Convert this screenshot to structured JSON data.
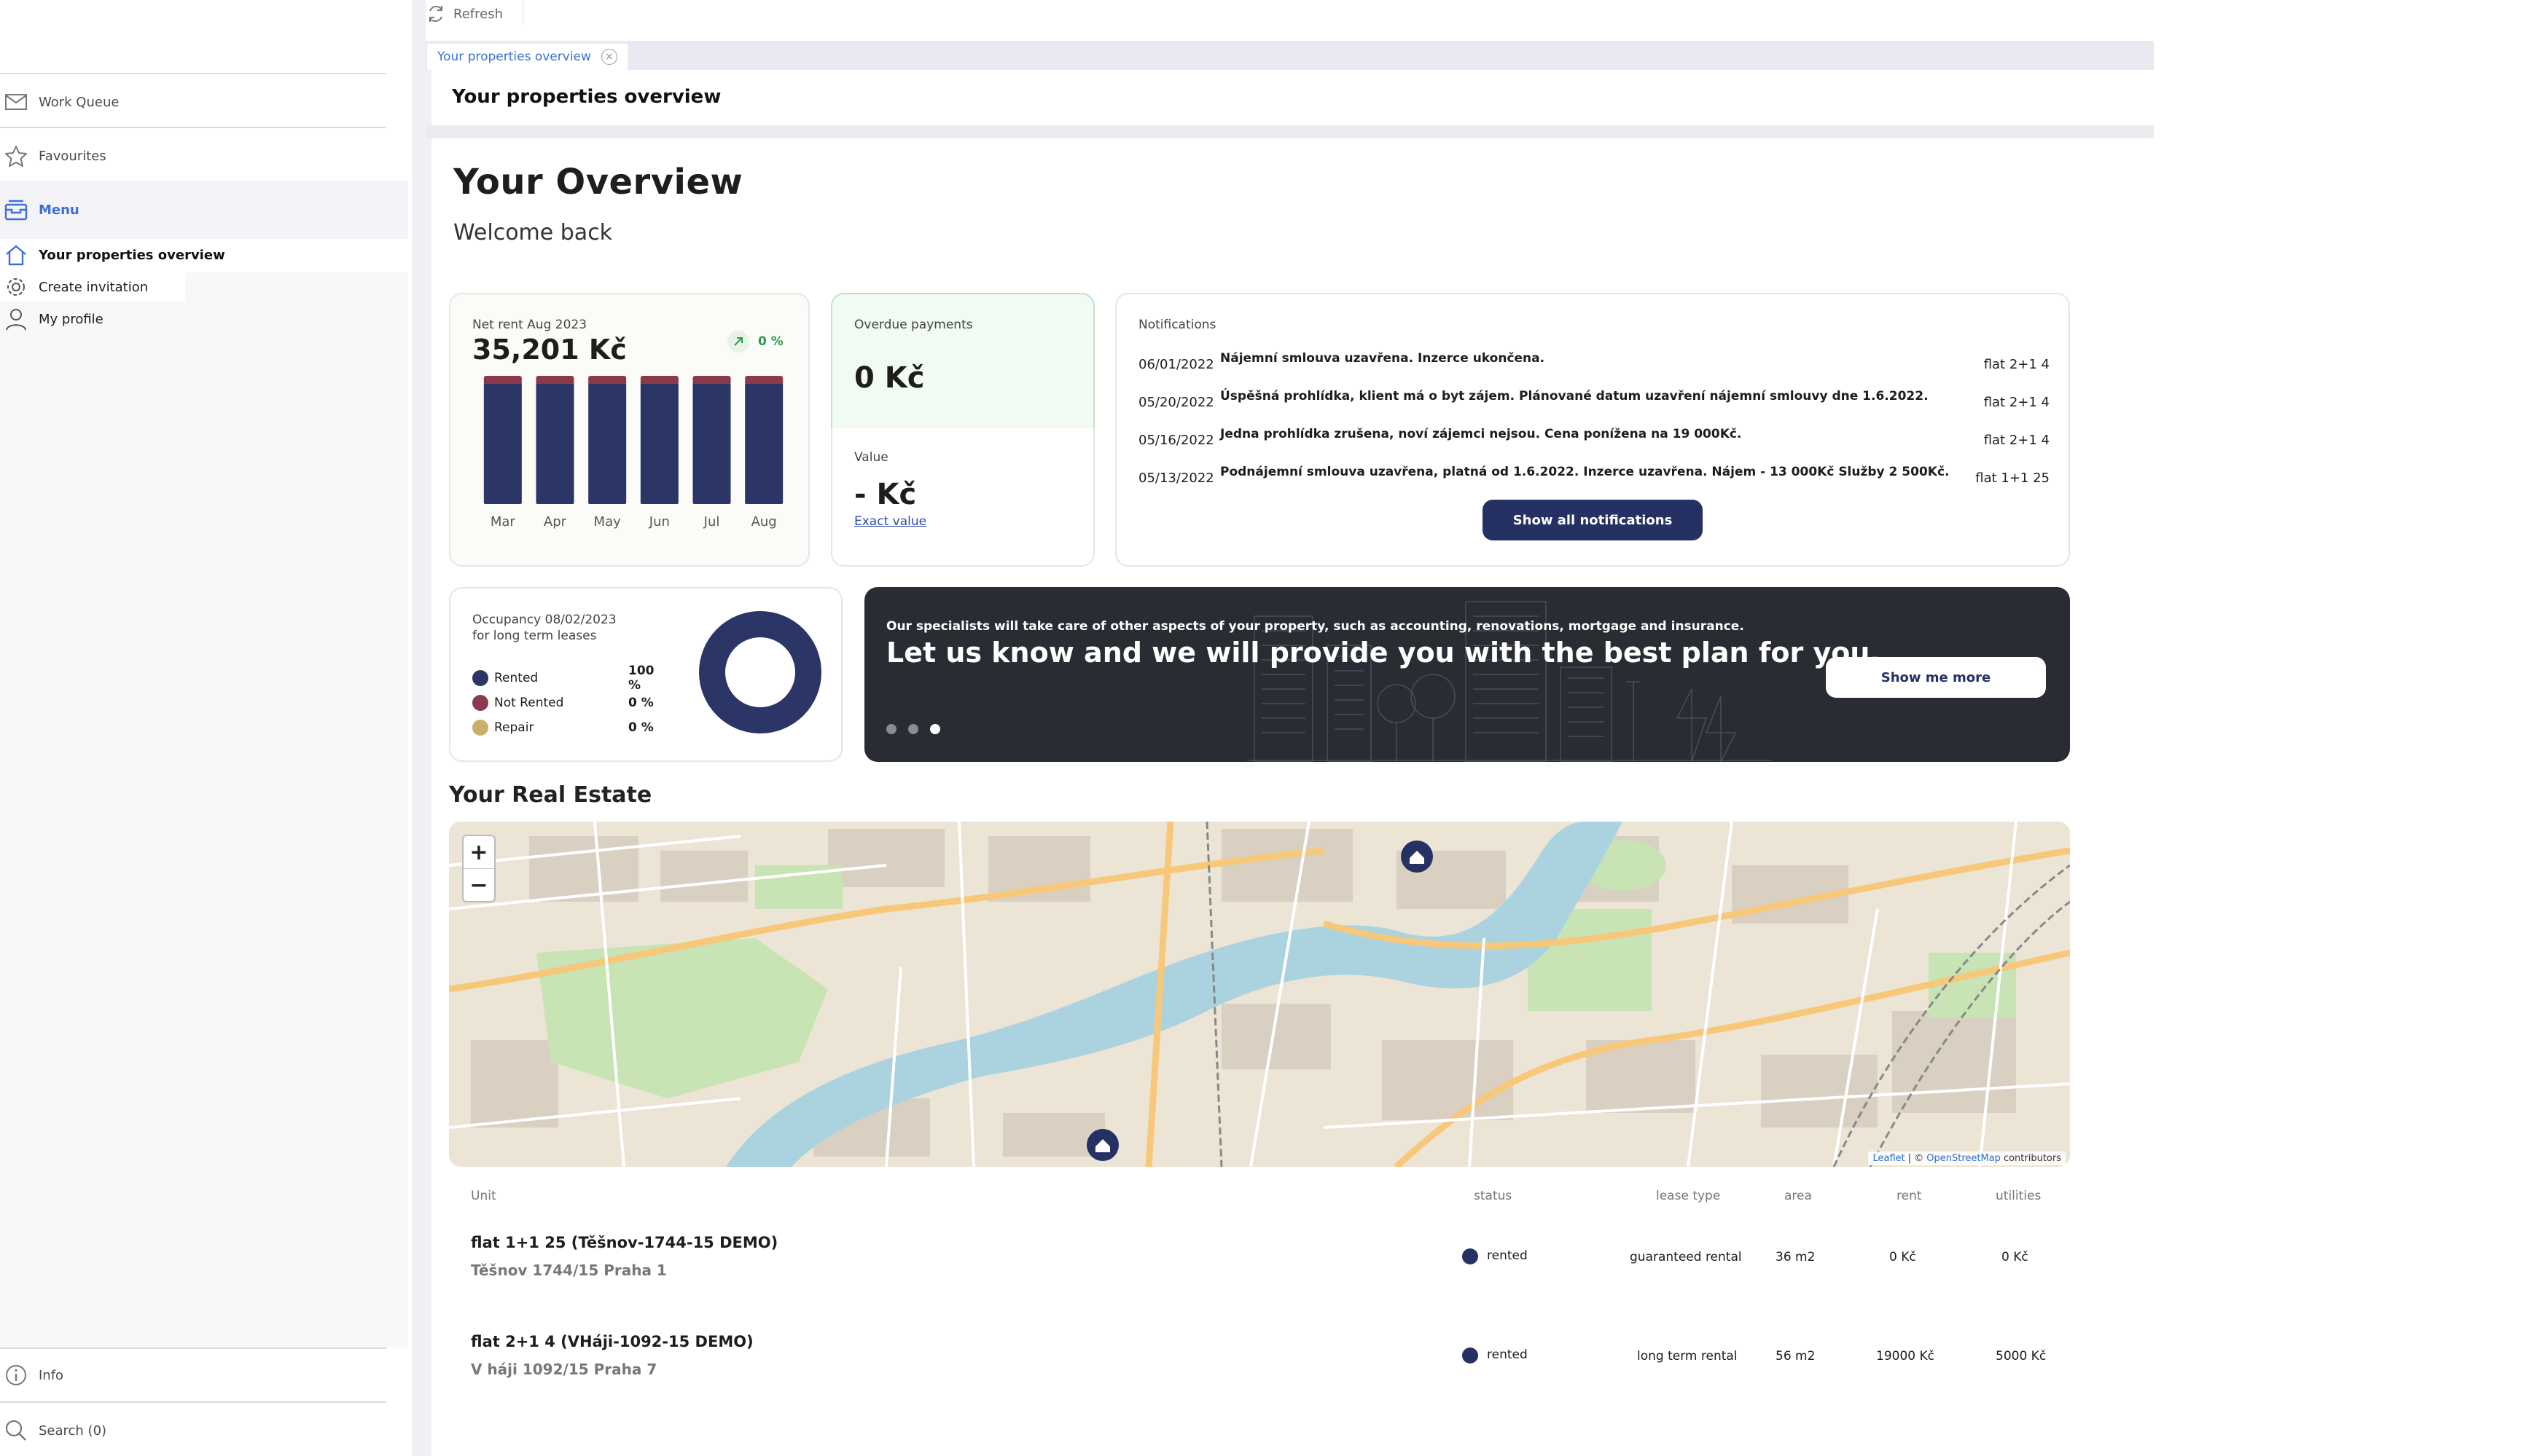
{
  "sidebar": {
    "items": [
      {
        "label": "Work Queue",
        "icon": "envelope-icon"
      },
      {
        "label": "Favourites",
        "icon": "star-icon"
      },
      {
        "label": "Menu",
        "icon": "inbox-icon"
      },
      {
        "label": "Your properties overview",
        "icon": "home-icon"
      },
      {
        "label": "Create invitation",
        "icon": "gear-icon"
      },
      {
        "label": "My profile",
        "icon": "user-icon"
      }
    ],
    "footer": [
      {
        "label": "Info",
        "icon": "info-icon"
      },
      {
        "label": "Search (0)",
        "icon": "search-icon"
      }
    ]
  },
  "toolbar": {
    "refresh_label": "Refresh"
  },
  "tabs": [
    {
      "label": "Your properties overview"
    }
  ],
  "page": {
    "heading": "Your properties overview",
    "title": "Your Overview",
    "welcome": "Welcome back"
  },
  "net_rent": {
    "label": "Net rent Aug 2023",
    "value": "35,201 Kč",
    "change": "0 %"
  },
  "overdue": {
    "label": "Overdue payments",
    "value": "0 Kč"
  },
  "value_card": {
    "label": "Value",
    "value": "- Kč",
    "link": "Exact value"
  },
  "notifications": {
    "title": "Notifications",
    "items": [
      {
        "date": "06/01/2022",
        "message": "Nájemní smlouva uzavřena. Inzerce ukončena.",
        "unit": "flat 2+1 4"
      },
      {
        "date": "05/20/2022",
        "message": "Úspěšná prohlídka, klient má o byt zájem. Plánované datum uzavření nájemní smlouvy dne 1.6.2022.",
        "unit": "flat 2+1 4"
      },
      {
        "date": "05/16/2022",
        "message": "Jedna prohlídka zrušena, noví zájemci nejsou. Cena ponížena na 19 000Kč.",
        "unit": "flat 2+1 4"
      },
      {
        "date": "05/13/2022",
        "message": "Podnájemní smlouva uzavřena, platná od 1.6.2022. Inzerce uzavřena. Nájem - 13 000Kč Služby 2 500Kč.",
        "unit": "flat 1+1 25"
      }
    ],
    "button": "Show all notifications"
  },
  "occupancy": {
    "title_line1": "Occupancy 08/02/2023",
    "title_line2": "for long term leases",
    "items": [
      {
        "label": "Rented",
        "value": "100 %",
        "color": "#2b3566"
      },
      {
        "label": "Not Rented",
        "value": "0 %",
        "color": "#8a3a4a"
      },
      {
        "label": "Repair",
        "value": "0 %",
        "color": "#c9b06a"
      }
    ]
  },
  "promo": {
    "small": "Our specialists will take care of other aspects of your property, such as accounting, renovations, mortgage and insurance.",
    "big": "Let us know and we will provide you with the best plan for you.",
    "button": "Show me more"
  },
  "real_estate": {
    "title": "Your Real Estate",
    "zoom_in": "+",
    "zoom_out": "−",
    "attribution": {
      "leaflet": "Leaflet",
      "sep": "| ©",
      "osm": "OpenStreetMap",
      "contrib": "contributors"
    }
  },
  "table": {
    "headers": {
      "unit": "Unit",
      "status": "status",
      "lease_type": "lease type",
      "area": "area",
      "rent": "rent",
      "utilities": "utilities"
    },
    "rows": [
      {
        "title": "flat 1+1 25 (Těšnov-1744-15 DEMO)",
        "address": "Těšnov 1744/15 Praha 1",
        "status": "rented",
        "lease_type": "guaranteed rental",
        "area": "36 m2",
        "rent": "0 Kč",
        "utilities": "0 Kč"
      },
      {
        "title": "flat 2+1 4 (VHáji-1092-15 DEMO)",
        "address": "V háji 1092/15 Praha 7",
        "status": "rented",
        "lease_type": "long term rental",
        "area": "56 m2",
        "rent": "19000 Kč",
        "utilities": "5000 Kč"
      }
    ]
  },
  "chart_data": {
    "type": "bar",
    "categories": [
      "Mar",
      "Apr",
      "May",
      "Jun",
      "Jul",
      "Aug"
    ],
    "series": [
      {
        "values": [
          33000,
          33000,
          33000,
          33000,
          33000,
          33000
        ],
        "color": "#2b3566"
      },
      {
        "values": [
          2201,
          2201,
          2201,
          2201,
          2201,
          2201
        ],
        "color": "#8a3a4a"
      }
    ]
  },
  "colors": {
    "primary": "#243162",
    "accent": "#3a6fd8",
    "positive": "#2e9a4a",
    "not_rented": "#8a3a4a",
    "repair": "#c9b06a"
  }
}
